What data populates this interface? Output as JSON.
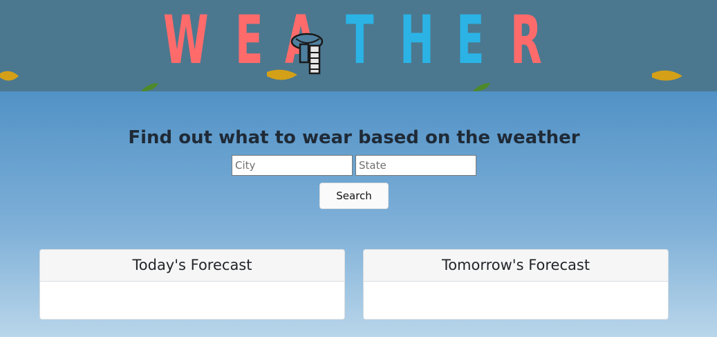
{
  "header": {
    "logo_letters": [
      {
        "char": "W",
        "color": "#ff6b6b"
      },
      {
        "char": "E",
        "color": "#ff6b6b"
      },
      {
        "char": "A",
        "color": "#ff6b6b"
      },
      {
        "char": "T",
        "color": "#2bb3e6"
      },
      {
        "char": "H",
        "color": "#2bb3e6"
      },
      {
        "char": "E",
        "color": "#2bb3e6"
      },
      {
        "char": "R",
        "color": "#ff6b6b"
      }
    ],
    "mascot_icon": "scarf-icon",
    "leaf_icon": "leaf-icon"
  },
  "main": {
    "title": "Find out what to wear based on the weather",
    "search": {
      "city_placeholder": "City",
      "state_placeholder": "State",
      "button_label": "Search"
    },
    "cards": {
      "today_title": "Today's Forecast",
      "tomorrow_title": "Tomorrow's Forecast"
    }
  },
  "colors": {
    "banner": "#4b788f",
    "sky_top": "#5192c6",
    "sky_bottom": "#b9d6ea",
    "logo_red": "#ff6b6b",
    "logo_blue": "#2bb3e6",
    "leaf_yellow": "#d4a017",
    "leaf_green": "#4f8a2b"
  }
}
